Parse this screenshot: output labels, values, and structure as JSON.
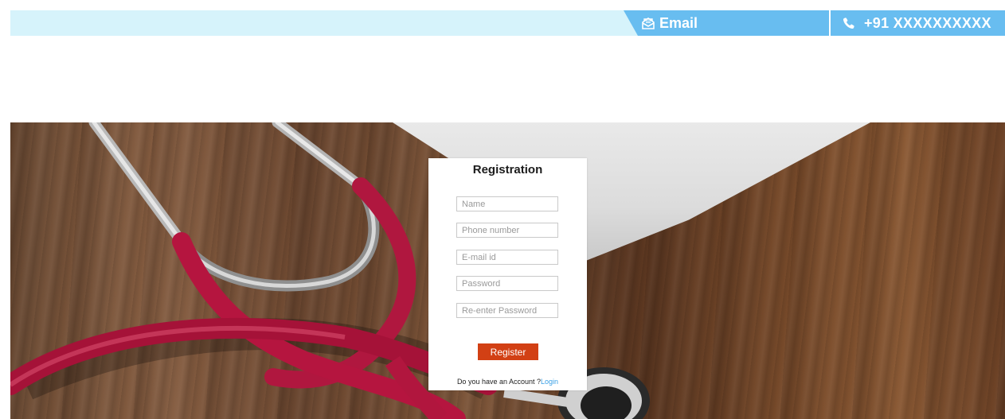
{
  "topbar": {
    "email_icon": "envelope-icon",
    "email_label": "Email",
    "phone_icon": "phone-icon",
    "phone_label": "+91 XXXXXXXXXX",
    "colors": {
      "bar": "#d6f3fb",
      "accent": "#68bdf0"
    }
  },
  "hero": {
    "image": "stethoscope-on-wooden-desk"
  },
  "registration": {
    "title": "Registration",
    "fields": [
      {
        "placeholder": "Name",
        "value": ""
      },
      {
        "placeholder": "Phone number",
        "value": ""
      },
      {
        "placeholder": "E-mail id",
        "value": ""
      },
      {
        "placeholder": "Password",
        "value": ""
      },
      {
        "placeholder": "Re-enter Password",
        "value": ""
      }
    ],
    "register_label": "Register",
    "account_prompt": "Do you have an Account ?",
    "login_label": "Login",
    "colors": {
      "button": "#d24014",
      "link": "#3aa0e6"
    }
  }
}
